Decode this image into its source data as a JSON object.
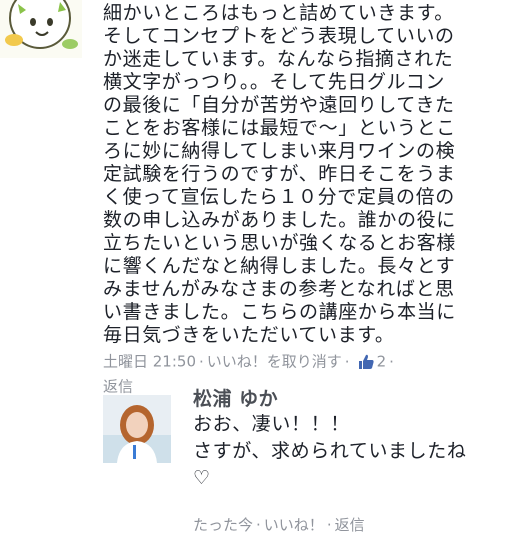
{
  "comment": {
    "lines": [
      "細かいところはもっと詰めていきます。",
      "そしてコンセプトをどう表現していいの",
      "か迷走しています。なんなら指摘された",
      "横文字がっつり。。そして先日グルコン",
      "の最後に「自分が苦労や遠回りしてきた",
      "ことをお客様には最短で〜」というとこ",
      "ろに妙に納得してしまい来月ワインの検",
      "定試験を行うのですが、昨日そこをうま",
      "く使って宣伝したら１０分で定員の倍の",
      "数の申し込みがありました。誰かの役に",
      "立ちたいという思いが強くなるとお客様",
      "に響くんだなと納得しました。長々とす",
      "みませんがみなさまの参考となればと思",
      "い書きました。こちらの講座から本当に",
      "毎日気づきをいただいています。"
    ],
    "meta": {
      "timestamp": "土曜日 21:50",
      "unlike": "いいね！を取り消す",
      "like_count": "2",
      "reply": "返信",
      "separator": "·"
    }
  },
  "reply": {
    "author": "松浦 ゆか",
    "lines": [
      "おお、凄い！！！",
      "さすが、求められていましたね",
      "♡"
    ],
    "meta": {
      "timestamp": "たった今",
      "like": "いいね！",
      "reply": "返信",
      "separator": "·"
    }
  },
  "colors": {
    "text": "#1d2129",
    "meta": "#90949c",
    "author": "#4b4f56",
    "like_blue": "#4267b2"
  }
}
